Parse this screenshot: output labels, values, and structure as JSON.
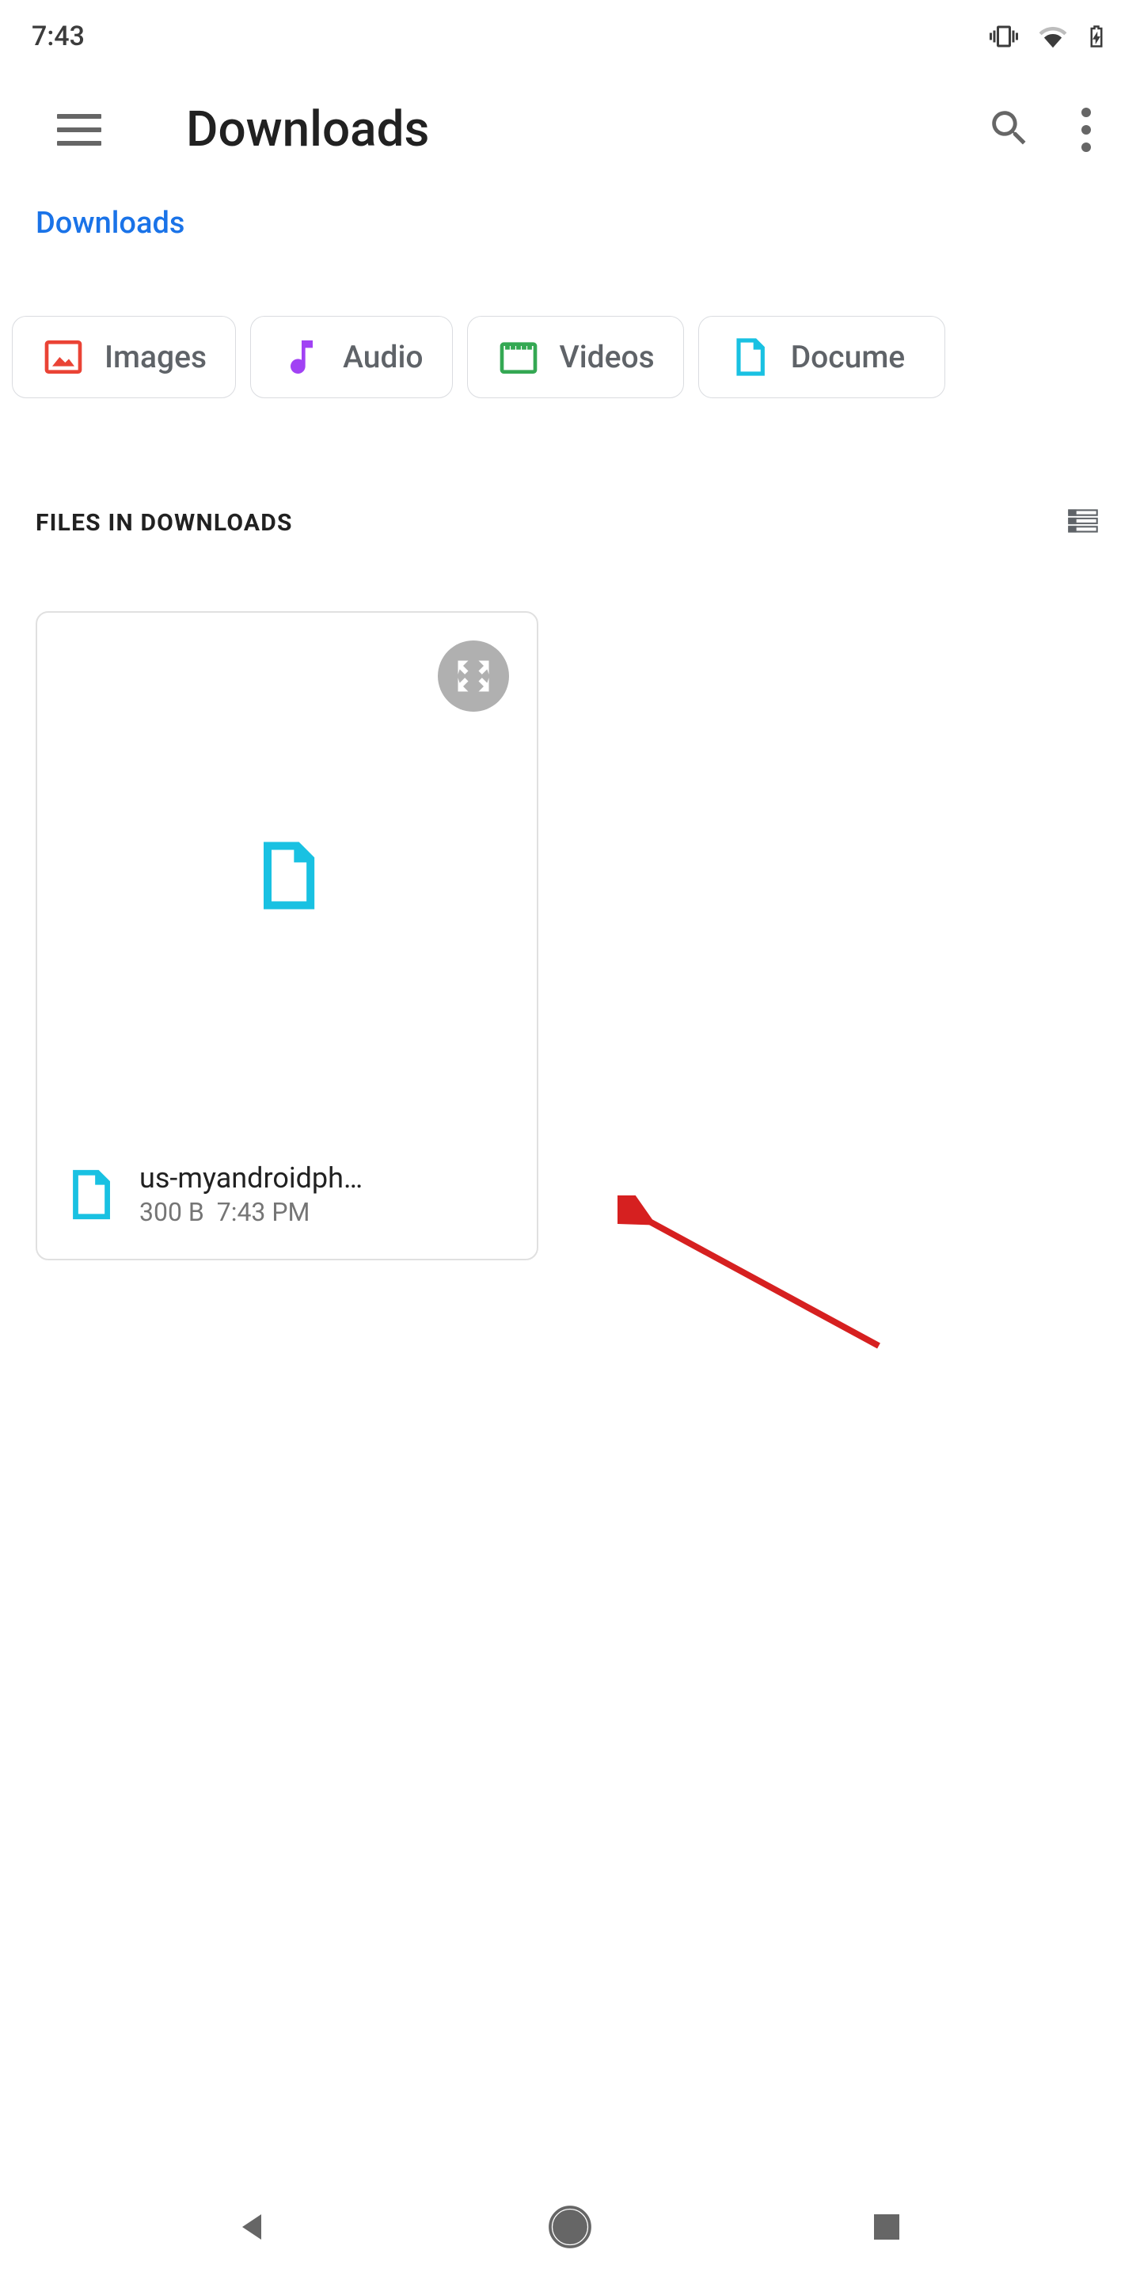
{
  "statusbar": {
    "time": "7:43"
  },
  "appbar": {
    "title": "Downloads"
  },
  "breadcrumb": {
    "current": "Downloads"
  },
  "filterChips": {
    "images": "Images",
    "audio": "Audio",
    "videos": "Videos",
    "documents": "Docume"
  },
  "section": {
    "title": "FILES IN DOWNLOADS"
  },
  "files": [
    {
      "name": "us-myandroidph…",
      "size": "300 B",
      "time": "7:43 PM"
    }
  ]
}
